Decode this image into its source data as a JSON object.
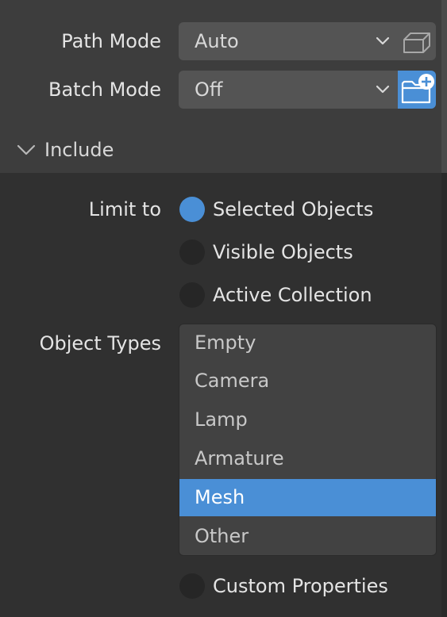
{
  "export": {
    "path_mode": {
      "label": "Path Mode",
      "value": "Auto"
    },
    "batch_mode": {
      "label": "Batch Mode",
      "value": "Off"
    }
  },
  "include": {
    "header": "Include",
    "limit_to": {
      "label": "Limit to",
      "options": [
        {
          "label": "Selected Objects",
          "selected": true
        },
        {
          "label": "Visible Objects",
          "selected": false
        },
        {
          "label": "Active Collection",
          "selected": false
        }
      ]
    },
    "object_types": {
      "label": "Object Types",
      "items": [
        {
          "label": "Empty",
          "selected": false
        },
        {
          "label": "Camera",
          "selected": false
        },
        {
          "label": "Lamp",
          "selected": false
        },
        {
          "label": "Armature",
          "selected": false
        },
        {
          "label": "Mesh",
          "selected": true
        },
        {
          "label": "Other",
          "selected": false
        }
      ]
    },
    "custom_properties": {
      "label": "Custom Properties",
      "checked": false
    }
  },
  "colors": {
    "accent": "#4a8fd6",
    "panel": "#3d3d3d",
    "background": "#303030",
    "field": "#545454"
  }
}
